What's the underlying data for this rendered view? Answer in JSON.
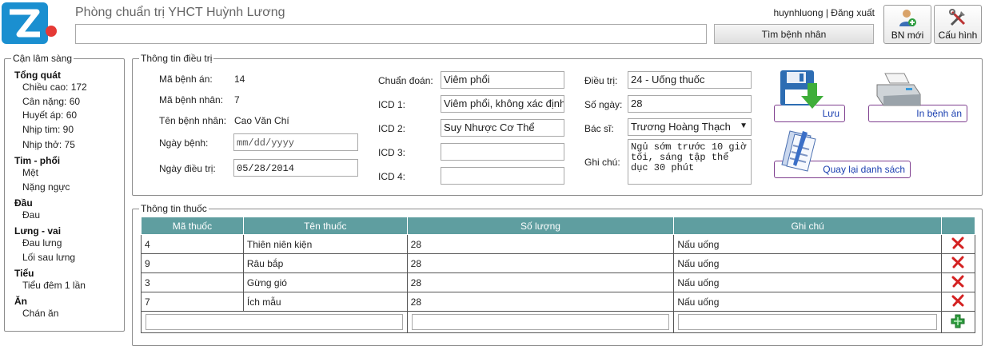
{
  "header": {
    "app_title": "Phòng chuẩn trị YHCT Huỳnh Lương",
    "search_value": "",
    "search_button": "Tìm bệnh nhân",
    "username": "huynhluong",
    "separator": " | ",
    "logout": "Đăng xuất",
    "new_patient_button": "BN mới",
    "config_button": "Cấu hình",
    "brand_color": "#1a8fd0"
  },
  "sidebar": {
    "legend": "Cận lâm sàng",
    "categories": [
      {
        "title": "Tổng quát",
        "items": [
          "Chiều cao: 172",
          "Cân nặng: 60",
          "Huyết áp: 60",
          "Nhịp tim: 90",
          "Nhịp thở: 75"
        ]
      },
      {
        "title": "Tim - phổi",
        "items": [
          "Mệt",
          "Nặng ngực"
        ]
      },
      {
        "title": "Đầu",
        "items": [
          "Đau"
        ]
      },
      {
        "title": "Lưng - vai",
        "items": [
          "Đau lưng",
          "Lối sau lưng"
        ]
      },
      {
        "title": "Tiểu",
        "items": [
          "Tiểu đêm 1 lần"
        ]
      },
      {
        "title": "Ăn",
        "items": [
          "Chán ăn"
        ]
      }
    ]
  },
  "treatment": {
    "legend": "Thông tin điều trị",
    "record_id_label": "Mã bệnh án:",
    "record_id": "14",
    "patient_id_label": "Mã bệnh nhân:",
    "patient_id": "7",
    "patient_name_label": "Tên bệnh nhân:",
    "patient_name": "Cao Văn Chí",
    "sick_date_label": "Ngày bệnh:",
    "sick_date": "mm/dd/yyyy",
    "treat_date_label": "Ngày điều trị:",
    "treat_date": "05/28/2014",
    "diagnosis_label": "Chuẩn đoán:",
    "diagnosis": "Viêm phổi",
    "icd1_label": "ICD 1:",
    "icd1": "Viêm phổi, không xác định",
    "icd2_label": "ICD 2:",
    "icd2": "Suy Nhược Cơ Thể",
    "icd3_label": "ICD 3:",
    "icd3": "",
    "icd4_label": "ICD 4:",
    "icd4": "",
    "therapy_label": "Điều trị:",
    "therapy": "24 - Uống thuốc",
    "days_label": "Số ngày:",
    "days": "28",
    "doctor_label": "Bác sĩ:",
    "doctor": "Trương Hoàng Thạch",
    "note_label": "Ghi chú:",
    "note": "Ngủ sớm trước 10 giờ tối, sáng tập thể dục 30 phút",
    "save_button": "Lưu",
    "print_button": "In bệnh án",
    "back_button": "Quay lại danh sách"
  },
  "medicine": {
    "legend": "Thông tin thuốc",
    "columns": [
      "Mã thuốc",
      "Tên thuốc",
      "Số lượng",
      "Ghi chú"
    ],
    "rows": [
      {
        "code": "4",
        "name": "Thiên niên kiện",
        "qty": "28",
        "note": "Nấu uống"
      },
      {
        "code": "9",
        "name": "Râu bắp",
        "qty": "28",
        "note": "Nấu uống"
      },
      {
        "code": "3",
        "name": "Gừng gió",
        "qty": "28",
        "note": "Nấu uống"
      },
      {
        "code": "7",
        "name": "Ích mẫu",
        "qty": "28",
        "note": "Nấu uống"
      }
    ],
    "header_color": "#5f9ea0",
    "delete_icon": "red-x-icon",
    "add_icon": "green-plus-icon"
  }
}
